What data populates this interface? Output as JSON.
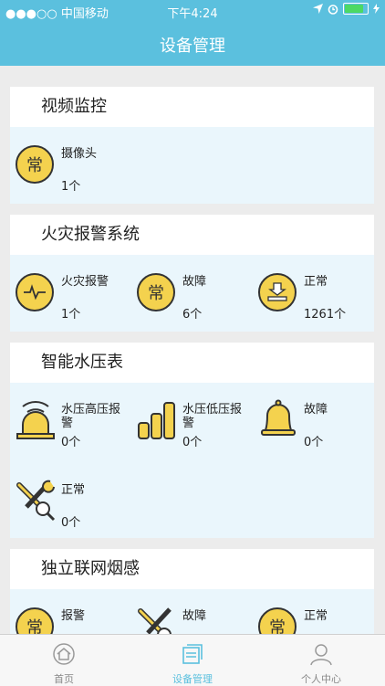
{
  "status": {
    "carrier": "●●●○○ 中国移动",
    "time": "下午4:24",
    "icons": [
      "location-icon",
      "alarm-icon",
      "battery-icon"
    ]
  },
  "header": {
    "title": "设备管理"
  },
  "sections": [
    {
      "title": "视频监控",
      "items": [
        {
          "label": "摄像头",
          "value": "1个",
          "icon": "常"
        }
      ]
    },
    {
      "title": "火灾报警系统",
      "items": [
        {
          "label": "火灾报警",
          "value": "1个",
          "icon": "pulse-icon"
        },
        {
          "label": "故障",
          "value": "6个",
          "icon": "常"
        },
        {
          "label": "正常",
          "value": "1261个",
          "icon": "download-tray-icon"
        }
      ]
    },
    {
      "title": "智能水压表",
      "items": [
        {
          "label": "水压高压报警",
          "value": "0个",
          "icon": "siren-icon"
        },
        {
          "label": "水压低压报警",
          "value": "0个",
          "icon": "bars-icon"
        },
        {
          "label": "故障",
          "value": "0个",
          "icon": "bell-icon"
        },
        {
          "label": "正常",
          "value": "0个",
          "icon": "tools-icon"
        }
      ]
    },
    {
      "title": "独立联网烟感",
      "items": [
        {
          "label": "报警",
          "value": "",
          "icon": "常"
        },
        {
          "label": "故障",
          "value": "",
          "icon": "tools-icon"
        },
        {
          "label": "正常",
          "value": "",
          "icon": "常"
        }
      ]
    }
  ],
  "tabs": [
    {
      "label": "首页",
      "active": false
    },
    {
      "label": "设备管理",
      "active": true
    },
    {
      "label": "个人中心",
      "active": false
    }
  ],
  "colors": {
    "accent": "#5bc0de",
    "icon_fill": "#f4d24e",
    "card_bg": "#eaf6fc"
  }
}
